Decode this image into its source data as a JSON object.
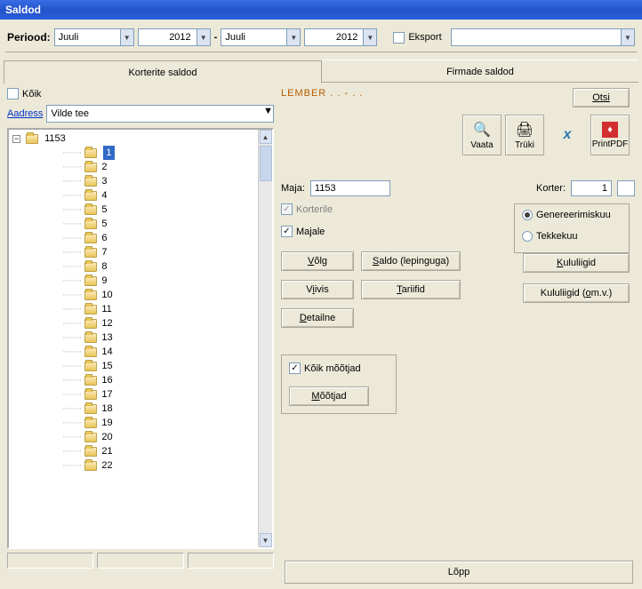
{
  "window": {
    "title": "Saldod"
  },
  "period": {
    "label": "Periood:",
    "from_month": "Juuli",
    "from_year": "2012",
    "to_month": "Juuli",
    "to_year": "2012",
    "export_label": "Eksport"
  },
  "tabs": {
    "apartments": "Korterite saldod",
    "companies": "Firmade saldod"
  },
  "left": {
    "all_label": "Kõik",
    "address_label": "Aadress",
    "address_value": "Vilde tee",
    "root": "1153",
    "items": [
      "1",
      "2",
      "3",
      "4",
      "5",
      "5",
      "6",
      "7",
      "8",
      "9",
      "10",
      "11",
      "12",
      "13",
      "14",
      "15",
      "16",
      "17",
      "18",
      "19",
      "20",
      "21",
      "22"
    ],
    "selected": "1"
  },
  "right": {
    "lember": "LEMBER   . .  -  . .",
    "otsi": "Otsi",
    "tool_vaata": "Vaata",
    "tool_truki": "Trüki",
    "tool_printpdf": "PrintPDF",
    "maja_label": "Maja:",
    "maja_value": "1153",
    "korter_label": "Korter:",
    "korter_value": "1",
    "chk_korterile": "Korterile",
    "chk_majale": "Majale",
    "rb_gen": "Genereerimiskuu",
    "rb_tek": "Tekkekuu",
    "btn_volg_u": "V",
    "btn_volg_r": "õlg",
    "btn_saldo_u": "S",
    "btn_saldo_r": "aldo (lepinguga)",
    "btn_viivis_u": "i",
    "btn_viivis_pre": "V",
    "btn_viivis_post": "ivis",
    "btn_tariifid_u": "T",
    "btn_tariifid_r": "ariifid",
    "btn_detailne_u": "D",
    "btn_detailne_r": "etailne",
    "btn_kulu_u": "K",
    "btn_kulu_r": "ululiigid",
    "btn_kuluomv_pre": "Kululiigid (",
    "btn_kuluomv_u": "o",
    "btn_kuluomv_post": "m.v.)",
    "chk_moot": "Kõik mõõtjad",
    "btn_moot_u": "M",
    "btn_moot_r": "õõtjad",
    "lopp_u": "L",
    "lopp_r": "õpp"
  }
}
